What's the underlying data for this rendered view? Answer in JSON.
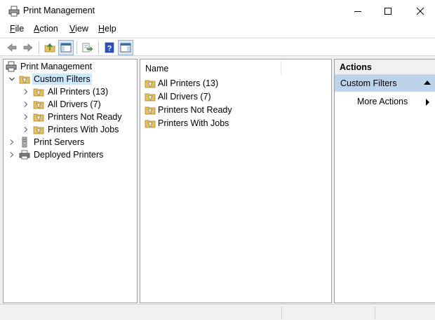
{
  "window": {
    "title": "Print Management"
  },
  "menu": [
    {
      "label": "File",
      "key": "F",
      "rest": "ile"
    },
    {
      "label": "Action",
      "key": "A",
      "rest": "ction"
    },
    {
      "label": "View",
      "key": "V",
      "rest": "iew"
    },
    {
      "label": "Help",
      "key": "H",
      "rest": "elp"
    }
  ],
  "toolbar": {
    "icons": [
      "back-arrow-icon",
      "forward-arrow-icon",
      "up-folder-icon",
      "show-hide-tree-icon",
      "export-list-icon",
      "help-icon",
      "show-hide-action-pane-icon"
    ]
  },
  "tree": {
    "root": "Print Management",
    "custom_filters": "Custom Filters",
    "filters": [
      "All Printers (13)",
      "All Drivers (7)",
      "Printers Not Ready",
      "Printers With Jobs"
    ],
    "print_servers": "Print Servers",
    "deployed_printers": "Deployed Printers"
  },
  "list": {
    "column_name": "Name",
    "items": [
      "All Printers (13)",
      "All Drivers (7)",
      "Printers Not Ready",
      "Printers With Jobs"
    ]
  },
  "actions": {
    "header": "Actions",
    "group": "Custom Filters",
    "more_actions": "More Actions"
  },
  "colors": {
    "selected_tree": "#cce8ff",
    "actions_group_bg": "#bcd3ec",
    "folder_yellow": "#e8c15a"
  }
}
